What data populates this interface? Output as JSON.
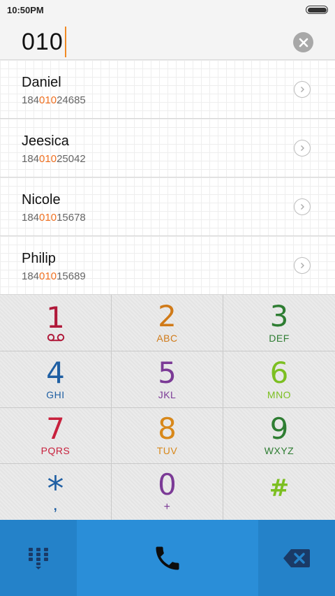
{
  "status_bar": {
    "time": "10:50PM"
  },
  "dialer": {
    "input_value": "010"
  },
  "contacts": [
    {
      "name": "Daniel",
      "number_prefix": "184",
      "number_match": "010",
      "number_suffix": "24685"
    },
    {
      "name": "Jeesica",
      "number_prefix": "184",
      "number_match": "010",
      "number_suffix": "25042"
    },
    {
      "name": "Nicole",
      "number_prefix": "184",
      "number_match": "010",
      "number_suffix": "15678"
    },
    {
      "name": "Philip",
      "number_prefix": "184",
      "number_match": "010",
      "number_suffix": "15689"
    }
  ],
  "keypad": [
    {
      "digit": "1",
      "letters": "",
      "color": "#b0193a",
      "icon": "voicemail-icon"
    },
    {
      "digit": "2",
      "letters": "ABC",
      "color": "#d07a18"
    },
    {
      "digit": "3",
      "letters": "DEF",
      "color": "#2e7d32"
    },
    {
      "digit": "4",
      "letters": "GHI",
      "color": "#1f5fa3"
    },
    {
      "digit": "5",
      "letters": "JKL",
      "color": "#7b3a96"
    },
    {
      "digit": "6",
      "letters": "MNO",
      "color": "#7cbf21"
    },
    {
      "digit": "7",
      "letters": "PQRS",
      "color": "#c8213d"
    },
    {
      "digit": "8",
      "letters": "TUV",
      "color": "#d8881a"
    },
    {
      "digit": "9",
      "letters": "WXYZ",
      "color": "#2e7d32"
    },
    {
      "digit": "*",
      "letters": ",",
      "color": "#1f5fa3"
    },
    {
      "digit": "0",
      "letters": "+",
      "color": "#7b3a96"
    },
    {
      "digit": "#",
      "letters": "",
      "color": "#7cbf21"
    }
  ],
  "action_bar": {
    "left_icon": "dialpad-collapse-icon",
    "center_icon": "phone-icon",
    "right_icon": "backspace-icon",
    "color": "#2a8ed8"
  },
  "highlight_color": "#f07020"
}
